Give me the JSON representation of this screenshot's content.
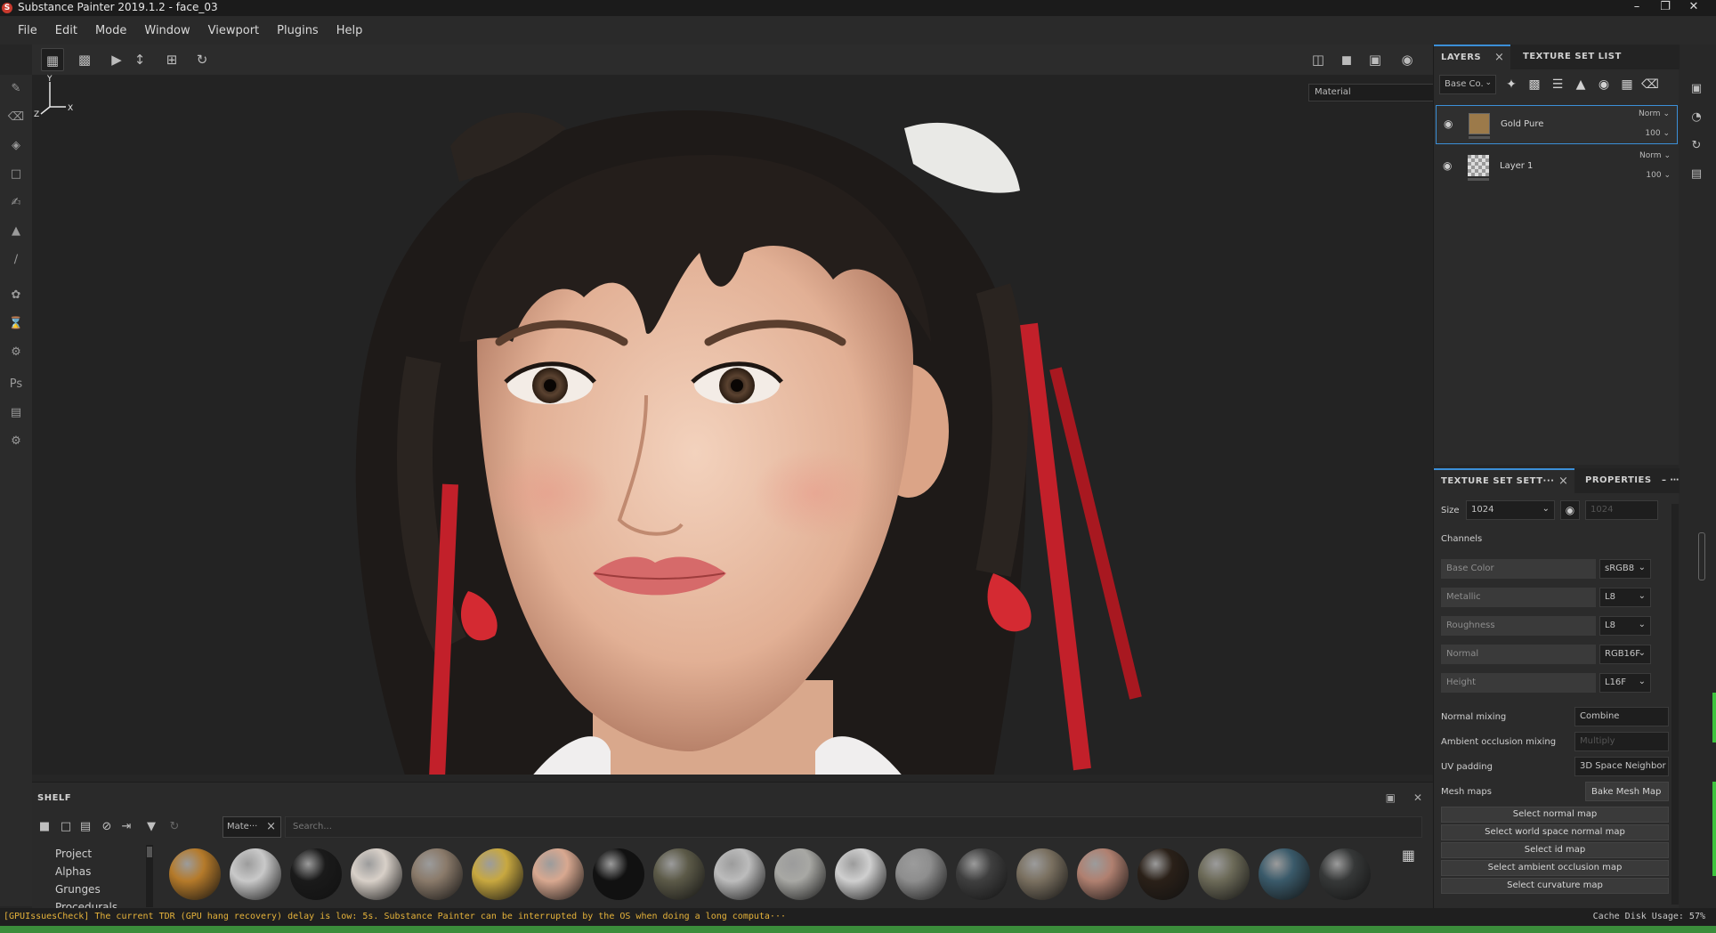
{
  "window": {
    "title": "Substance Painter 2019.1.2 - face_03",
    "app_icon": "S"
  },
  "menu": [
    "File",
    "Edit",
    "Mode",
    "Window",
    "Viewport",
    "Plugins",
    "Help"
  ],
  "viewport": {
    "display_mode": "Material",
    "axes": {
      "y": "Y",
      "x": "X",
      "z": "Z"
    }
  },
  "layers_panel": {
    "tabs": [
      "LAYERS",
      "TEXTURE SET LIST"
    ],
    "channel_select": "Base Co.",
    "layers": [
      {
        "name": "Gold Pure",
        "blend": "Norm",
        "opacity": "100",
        "selected": true,
        "thumb_color": "#9c7a4a"
      },
      {
        "name": "Layer 1",
        "blend": "Norm",
        "opacity": "100",
        "selected": false,
        "thumb_color": "checker"
      }
    ]
  },
  "texture_set_settings": {
    "tabs": [
      "TEXTURE SET SETT···",
      "PROPERTIES"
    ],
    "size_label": "Size",
    "size_value": "1024",
    "size_locked_value": "1024",
    "channels_label": "Channels",
    "channels": [
      {
        "name": "Base Color",
        "format": "sRGB8"
      },
      {
        "name": "Metallic",
        "format": "L8"
      },
      {
        "name": "Roughness",
        "format": "L8"
      },
      {
        "name": "Normal",
        "format": "RGB16F"
      },
      {
        "name": "Height",
        "format": "L16F"
      }
    ],
    "normal_mixing_label": "Normal mixing",
    "normal_mixing_value": "Combine",
    "ao_mixing_label": "Ambient occlusion mixing",
    "ao_mixing_value": "Multiply",
    "uv_padding_label": "UV padding",
    "uv_padding_value": "3D Space Neighbor",
    "mesh_maps_label": "Mesh maps",
    "bake_button": "Bake Mesh Map",
    "select_buttons": [
      "Select normal map",
      "Select world space normal map",
      "Select id map",
      "Select ambient occlusion map",
      "Select curvature map"
    ]
  },
  "shelf": {
    "title": "SHELF",
    "filter_tag": "Mate···",
    "search_placeholder": "Search...",
    "categories": [
      "Project",
      "Alphas",
      "Grunges",
      "Procedurals"
    ],
    "spheres": [
      "#b57a2a",
      "#c9c9c9",
      "#1a1a1a",
      "#d8d0c8",
      "#8a7a6a",
      "#c8a840",
      "#d8a890",
      "#111111",
      "#5c5a48",
      "#bcbcbc",
      "#a8a8a4",
      "#cfcfcf",
      "#8e8e8e",
      "#3f3f3f",
      "#7a7060",
      "#b08070",
      "#2a2018",
      "#6c6a58",
      "#3a5a6a",
      "#363838"
    ]
  },
  "status": {
    "message": "[GPUIssuesCheck] The current TDR (GPU hang recovery) delay is low: 5s. Substance Painter can be interrupted by the OS when doing a long computa···",
    "cache": "Cache Disk Usage:   57%"
  }
}
